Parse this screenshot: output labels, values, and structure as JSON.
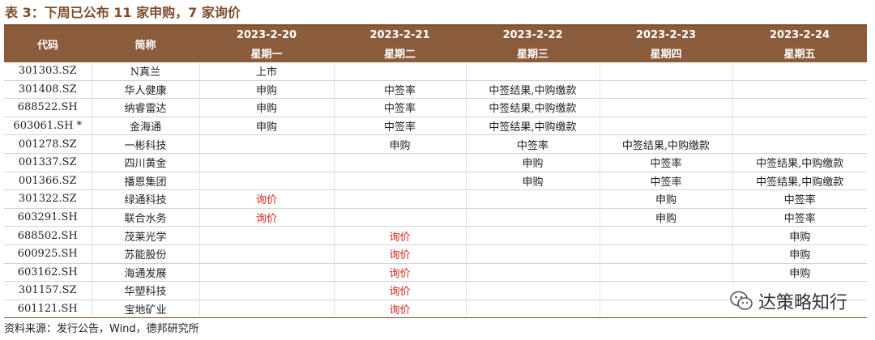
{
  "title": "表 3：下周已公布 11 家申购，7 家询价",
  "header": {
    "code_label": "代码",
    "name_label": "简称",
    "dates": [
      "2023-2-20",
      "2023-2-21",
      "2023-2-22",
      "2023-2-23",
      "2023-2-24"
    ],
    "weekdays": [
      "星期一",
      "星期二",
      "星期三",
      "星期四",
      "星期五"
    ]
  },
  "rows": [
    {
      "code": "301303.SZ",
      "name": "N真兰",
      "days": [
        "上市",
        "",
        "",
        "",
        ""
      ]
    },
    {
      "code": "301408.SZ",
      "name": "华人健康",
      "days": [
        "申购",
        "中签率",
        "中签结果,中购缴款",
        "",
        ""
      ]
    },
    {
      "code": "688522.SH",
      "name": "纳睿雷达",
      "days": [
        "申购",
        "中签率",
        "中签结果,中购缴款",
        "",
        ""
      ]
    },
    {
      "code": "603061.SH *",
      "name": "金海通",
      "days": [
        "申购",
        "中签率",
        "中签结果,中购缴款",
        "",
        ""
      ]
    },
    {
      "code": "001278.SZ",
      "name": "一彬科技",
      "days": [
        "",
        "申购",
        "中签率",
        "中签结果,中购缴款",
        ""
      ]
    },
    {
      "code": "001337.SZ",
      "name": "四川黄金",
      "days": [
        "",
        "",
        "申购",
        "中签率",
        "中签结果,中购缴款"
      ]
    },
    {
      "code": "001366.SZ",
      "name": "播恩集团",
      "days": [
        "",
        "",
        "申购",
        "中签率",
        "中签结果,中购缴款"
      ]
    },
    {
      "code": "301322.SZ",
      "name": "绿通科技",
      "days": [
        "询价",
        "",
        "",
        "申购",
        "中签率"
      ]
    },
    {
      "code": "603291.SH",
      "name": "联合水务",
      "days": [
        "询价",
        "",
        "",
        "申购",
        "中签率"
      ]
    },
    {
      "code": "688502.SH",
      "name": "茂莱光学",
      "days": [
        "",
        "询价",
        "",
        "",
        "申购"
      ]
    },
    {
      "code": "600925.SH",
      "name": "苏能股份",
      "days": [
        "",
        "询价",
        "",
        "",
        "申购"
      ]
    },
    {
      "code": "603162.SH",
      "name": "海通发展",
      "days": [
        "",
        "询价",
        "",
        "",
        "申购"
      ]
    },
    {
      "code": "301157.SZ",
      "name": "华塑科技",
      "days": [
        "",
        "询价",
        "",
        "",
        ""
      ]
    },
    {
      "code": "601121.SH",
      "name": "宝地矿业",
      "days": [
        "",
        "询价",
        "",
        "",
        ""
      ]
    }
  ],
  "highlight_value": "询价",
  "highlight_color": "#e0241b",
  "source": "资料来源：发行公告，Wind，德邦研究所",
  "watermark": "达策略知行"
}
